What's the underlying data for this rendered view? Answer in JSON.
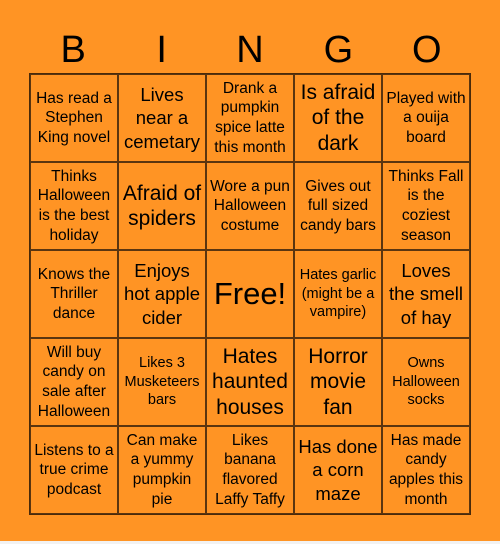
{
  "header": {
    "letters": [
      "B",
      "I",
      "N",
      "G",
      "O"
    ]
  },
  "cells": [
    {
      "text": "Has read a Stephen King novel",
      "size": "m"
    },
    {
      "text": "Lives near a cemetary",
      "size": "l"
    },
    {
      "text": "Drank a pumpkin spice latte this month",
      "size": "m"
    },
    {
      "text": "Is afraid of the dark",
      "size": "xl"
    },
    {
      "text": "Played with a ouija board",
      "size": "m"
    },
    {
      "text": "Thinks Halloween is the best holiday",
      "size": "m"
    },
    {
      "text": "Afraid of spiders",
      "size": "xl"
    },
    {
      "text": "Wore a pun Halloween costume",
      "size": "m"
    },
    {
      "text": "Gives out full sized candy bars",
      "size": "m"
    },
    {
      "text": "Thinks Fall is the coziest season",
      "size": "m"
    },
    {
      "text": "Knows the Thriller dance",
      "size": "m"
    },
    {
      "text": "Enjoys hot apple cider",
      "size": "l"
    },
    {
      "text": "Free!",
      "size": "free"
    },
    {
      "text": "Hates garlic (might be a vampire)",
      "size": "s"
    },
    {
      "text": "Loves the smell of hay",
      "size": "l"
    },
    {
      "text": "Will buy candy on sale after Halloween",
      "size": "m"
    },
    {
      "text": "Likes 3 Musketeers bars",
      "size": "s"
    },
    {
      "text": "Hates haunted houses",
      "size": "xl"
    },
    {
      "text": "Horror movie fan",
      "size": "xl"
    },
    {
      "text": "Owns Halloween socks",
      "size": "s"
    },
    {
      "text": "Listens to a true crime podcast",
      "size": "m"
    },
    {
      "text": "Can make a yummy pumpkin pie",
      "size": "m"
    },
    {
      "text": "Likes banana flavored Laffy Taffy",
      "size": "m"
    },
    {
      "text": "Has done a corn maze",
      "size": "l"
    },
    {
      "text": "Has made candy apples this month",
      "size": "m"
    }
  ],
  "colors": {
    "background": "#FF9424",
    "grid_line": "#5a3510",
    "text": "#000000"
  }
}
